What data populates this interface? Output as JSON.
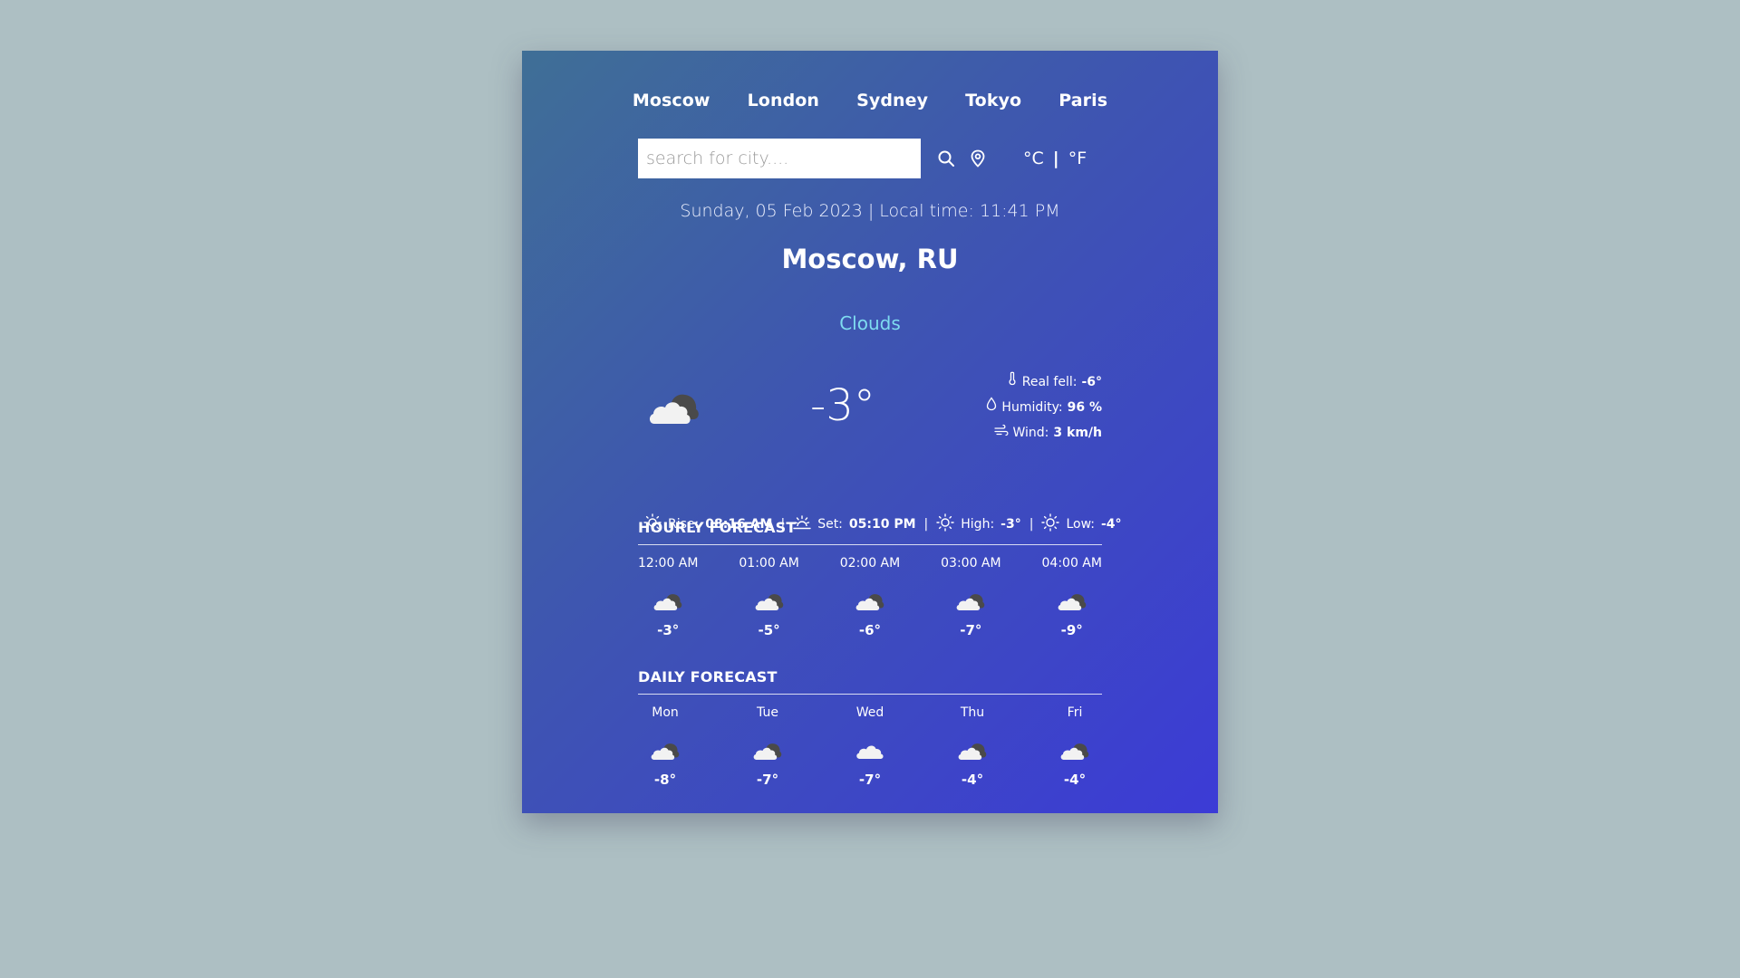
{
  "cities": [
    "Moscow",
    "London",
    "Sydney",
    "Tokyo",
    "Paris"
  ],
  "search": {
    "placeholder": "search for city...."
  },
  "units": {
    "celsius": "°C",
    "separator": "|",
    "fahrenheit": "°F"
  },
  "datetime": "Sunday, 05 Feb 2023 | Local time: 11:41 PM",
  "location": "Moscow, RU",
  "condition": "Clouds",
  "current": {
    "temp": "-3°",
    "icon": "broken-clouds-icon",
    "real_feel_label": "Real fell:",
    "real_feel_value": "-6°",
    "humidity_label": "Humidity:",
    "humidity_value": "96 %",
    "wind_label": "Wind:",
    "wind_value": "3 km/h"
  },
  "sun": {
    "rise_label": "Rise:",
    "rise_value": "08:16 AM",
    "set_label": "Set:",
    "set_value": "05:10 PM",
    "high_label": "High:",
    "high_value": "-3°",
    "low_label": "Low:",
    "low_value": "-4°",
    "separator": "|"
  },
  "hourly": {
    "title": "HOURLY FORECAST",
    "items": [
      {
        "label": "12:00 AM",
        "temp": "-3°",
        "icon": "broken-clouds-icon"
      },
      {
        "label": "01:00 AM",
        "temp": "-5°",
        "icon": "broken-clouds-icon"
      },
      {
        "label": "02:00 AM",
        "temp": "-6°",
        "icon": "broken-clouds-icon"
      },
      {
        "label": "03:00 AM",
        "temp": "-7°",
        "icon": "broken-clouds-icon"
      },
      {
        "label": "04:00 AM",
        "temp": "-9°",
        "icon": "broken-clouds-icon"
      }
    ]
  },
  "daily": {
    "title": "DAILY FORECAST",
    "items": [
      {
        "label": "Mon",
        "temp": "-8°",
        "icon": "broken-clouds-icon"
      },
      {
        "label": "Tue",
        "temp": "-7°",
        "icon": "broken-clouds-icon"
      },
      {
        "label": "Wed",
        "temp": "-7°",
        "icon": "cloud-icon"
      },
      {
        "label": "Thu",
        "temp": "-4°",
        "icon": "broken-clouds-icon"
      },
      {
        "label": "Fri",
        "temp": "-4°",
        "icon": "broken-clouds-icon"
      }
    ]
  },
  "colors": {
    "background": "#adbfc3",
    "card_gradient_start": "#3f6f96",
    "card_gradient_end": "#3c3bd6",
    "condition_text": "#7fdcf0"
  }
}
